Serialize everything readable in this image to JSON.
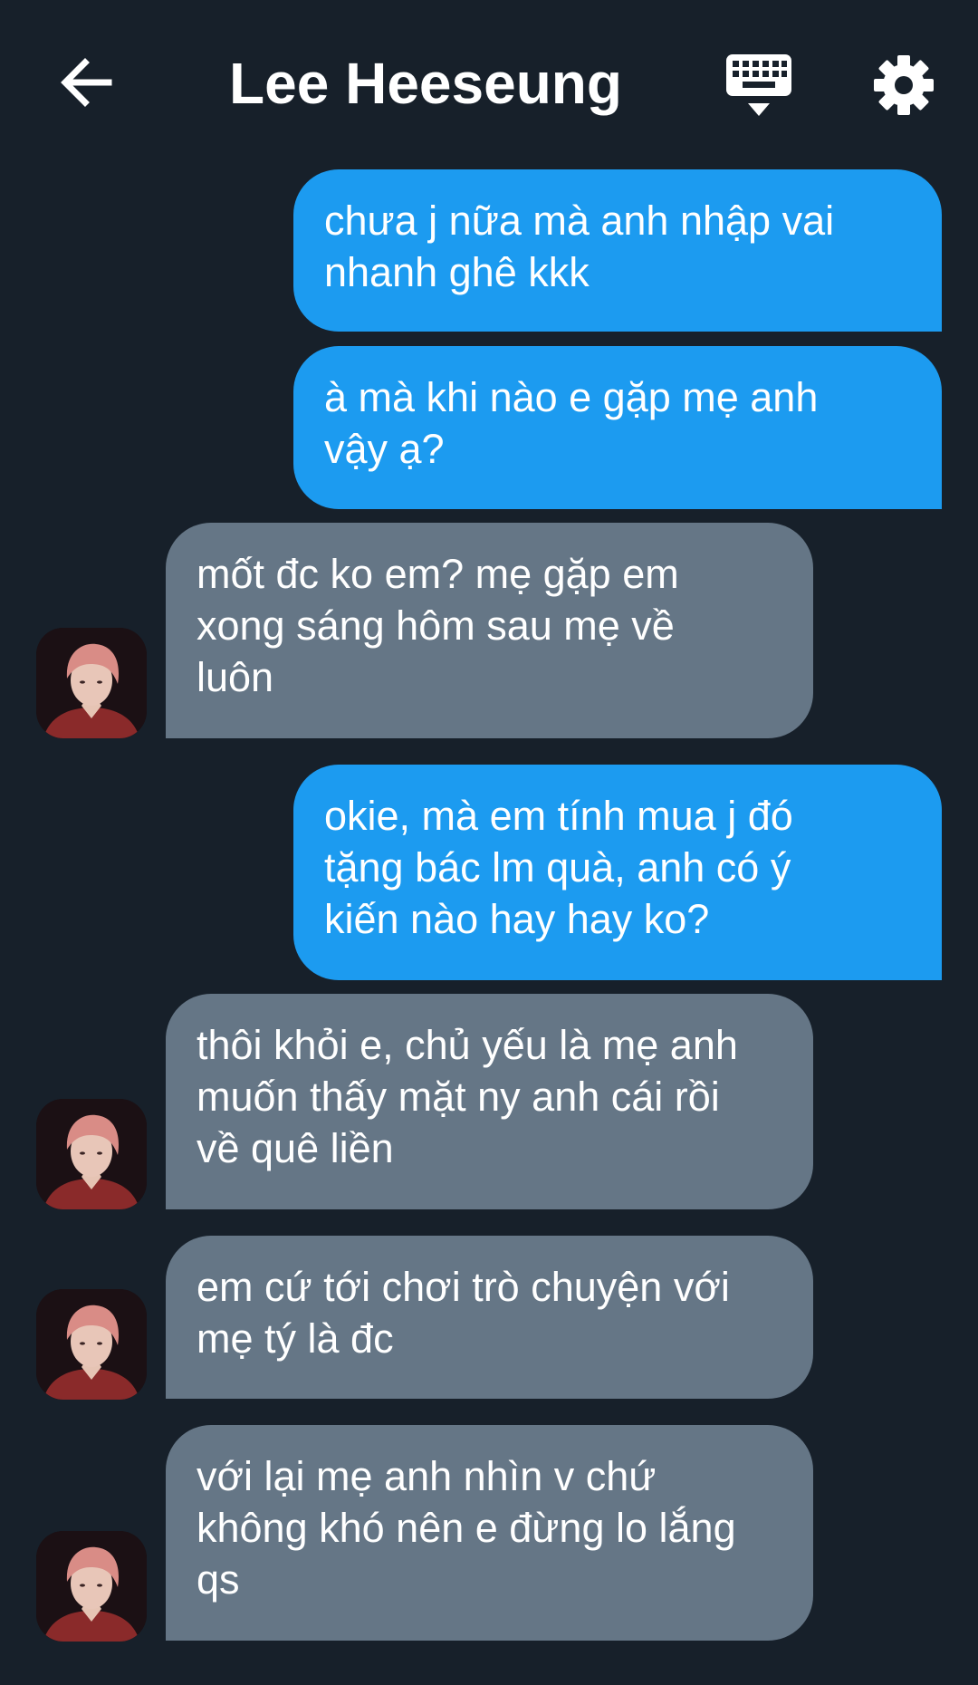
{
  "header": {
    "title": "Lee Heeseung",
    "back_icon": "arrow-left-icon",
    "keyboard_icon": "keyboard-icon",
    "settings_icon": "gear-icon"
  },
  "colors": {
    "background": "#17202a",
    "sent_bubble": "#1c9bf0",
    "received_bubble": "#657686",
    "text": "#ffffff"
  },
  "messages": [
    {
      "side": "sent",
      "line1": "chưa j nữa mà anh nhập vai",
      "line2": "nhanh ghê kkk"
    },
    {
      "side": "sent",
      "line1": "à mà khi nào e gặp mẹ anh",
      "line2": "vậy ạ?"
    },
    {
      "side": "received",
      "line1": "mốt đc ko em? mẹ gặp em",
      "line2": "xong sáng hôm sau mẹ về",
      "line3": "luôn"
    },
    {
      "side": "sent",
      "line1": "okie, mà em tính mua j đó",
      "line2": "tặng bác lm quà, anh có ý",
      "line3": "kiến nào hay hay ko?"
    },
    {
      "side": "received",
      "line1": "thôi khỏi e, chủ yếu là mẹ anh",
      "line2": "muốn thấy mặt ny anh cái rồi",
      "line3": "về quê liền"
    },
    {
      "side": "received",
      "line1": "em cứ tới chơi trò chuyện với",
      "line2": "mẹ tý là đc"
    },
    {
      "side": "received",
      "line1": "với lại mẹ anh nhìn v chứ",
      "line2": "không khó nên e đừng lo lắng",
      "line3": "qs"
    }
  ]
}
